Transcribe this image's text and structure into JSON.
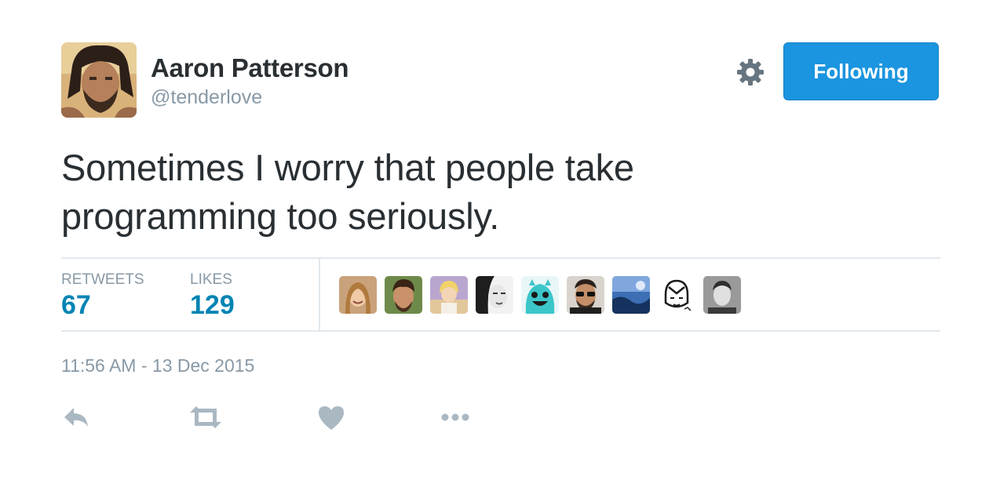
{
  "author": {
    "name": "Aaron Patterson",
    "handle": "@tenderlove",
    "avatar_icon": "user-avatar"
  },
  "header": {
    "settings_icon": "gear-icon",
    "follow_label": "Following",
    "follow_color": "#1b95e0"
  },
  "tweet": {
    "text": "Sometimes I worry that people take\nprogramming too seriously."
  },
  "stats": {
    "retweets_label": "RETWEETS",
    "retweets_count": "67",
    "likes_label": "LIKES",
    "likes_count": "129",
    "count_color": "#0084b4"
  },
  "likers": [
    {
      "icon": "liker-avatar-1"
    },
    {
      "icon": "liker-avatar-2"
    },
    {
      "icon": "liker-avatar-3"
    },
    {
      "icon": "liker-avatar-4"
    },
    {
      "icon": "liker-avatar-5"
    },
    {
      "icon": "liker-avatar-6"
    },
    {
      "icon": "liker-avatar-7"
    },
    {
      "icon": "liker-avatar-8"
    },
    {
      "icon": "liker-avatar-9"
    }
  ],
  "timestamp": "11:56 AM - 13 Dec 2015",
  "actions": [
    {
      "icon": "reply-icon"
    },
    {
      "icon": "retweet-icon"
    },
    {
      "icon": "heart-icon"
    },
    {
      "icon": "more-icon"
    }
  ]
}
